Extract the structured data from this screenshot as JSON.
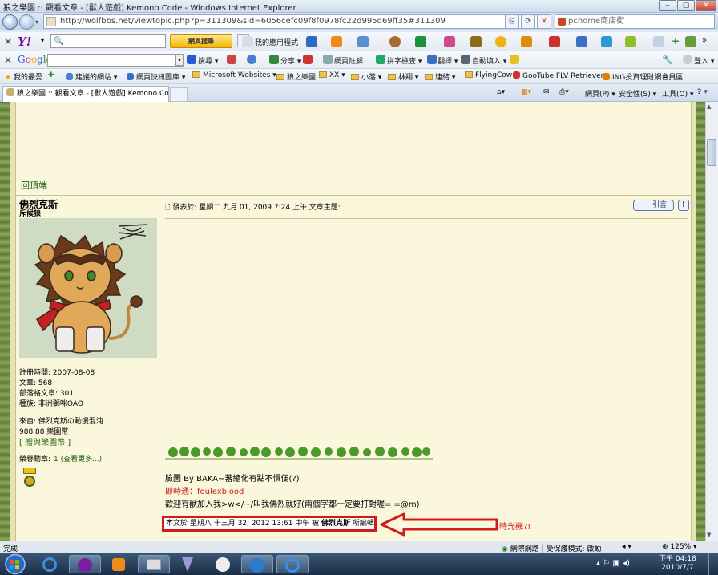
{
  "window": {
    "title": "狼之樂園 :: 觀看文章 - [獸人遊戲] Kemono Code - Windows Internet Explorer"
  },
  "address_bar": {
    "url": "http://wolfbbs.net/viewtopic.php?p=311309&sid=6056cefc09f8f0978fc22d995d69ff35#311309",
    "search_placeholder": "pchome商店街"
  },
  "yahoo_toolbar": {
    "search_button": "網頁搜尋",
    "apps_label": "我的應用程式"
  },
  "google_toolbar": {
    "logo": "Google",
    "items": [
      "搜尋 ▾",
      "分享 ▾",
      "網頁註解",
      "拼字檢查 ▾",
      "翻譯 ▾",
      "自動填入 ▾"
    ],
    "signin": "登入 ▾"
  },
  "favorites_bar": {
    "label": "我的最愛",
    "items": [
      "建議的網站 ▾",
      "網頁快訊圖庫 ▾",
      "Microsoft Websites ▾",
      "狼之樂園",
      "XX ▾",
      "小落 ▾",
      "林翔 ▾",
      "連結 ▾",
      "FlyingCow",
      "GooTube FLV Retriever",
      "ING投資理財網會員區"
    ]
  },
  "tabs": {
    "active": "狼之樂園 :: 觀看文章 - [獸人遊戲] Kemono Code"
  },
  "command_bar": {
    "page": "網頁(P) ▾",
    "safety": "安全性(S) ▾",
    "tools": "工具(O) ▾",
    "help": "? ▾"
  },
  "post": {
    "back_to_top": "回頂端",
    "poster_name": "佛烈克斯",
    "poster_rank": "斥候狼",
    "info": [
      "註冊時間: 2007-08-08",
      "文章: 568",
      "部落格文章: 301",
      "種族: 非洲獅咪OAO"
    ],
    "from": "來自: 佛烈克斯の動漫混沌",
    "coins": "988.88 樂園幣",
    "gift_link": "[ 贈與樂園幣 ]",
    "medals_label": "榮譽勳章:",
    "medals_more": "1 (查看更多...)",
    "meta": "發表於: 星期二 九月 01, 2009 7:24 上午     文章主題:",
    "quote_label": "引言",
    "signature": {
      "line1": "臉圖 By BAKA~蕃縮化有點不慣便(?)",
      "line2": "即時通：foulexblood",
      "line3": "歡迎有獸加入我>w</~/叫我佛烈就好(兩個字都一定要打對喔= =@m)"
    },
    "edit_note_prefix": "本文於 星期八 十三月 32, 2012 13:61 中午 被 ",
    "edit_note_user": "佛烈克斯",
    "edit_note_suffix": " 所編輯",
    "annotation": "時光機?!"
  },
  "status_bar": {
    "left": "完成",
    "zone": "網際網路 | 受保護模式: 啟動",
    "zoom": "125%"
  },
  "taskbar": {
    "time": "下午 04:18",
    "date": "2010/7/7"
  },
  "colors": {
    "forum_bg": "#fbf7dc",
    "border_green": "#5e7a38",
    "highlight_red": "#d21a1a",
    "link_green": "#1f5f12"
  }
}
